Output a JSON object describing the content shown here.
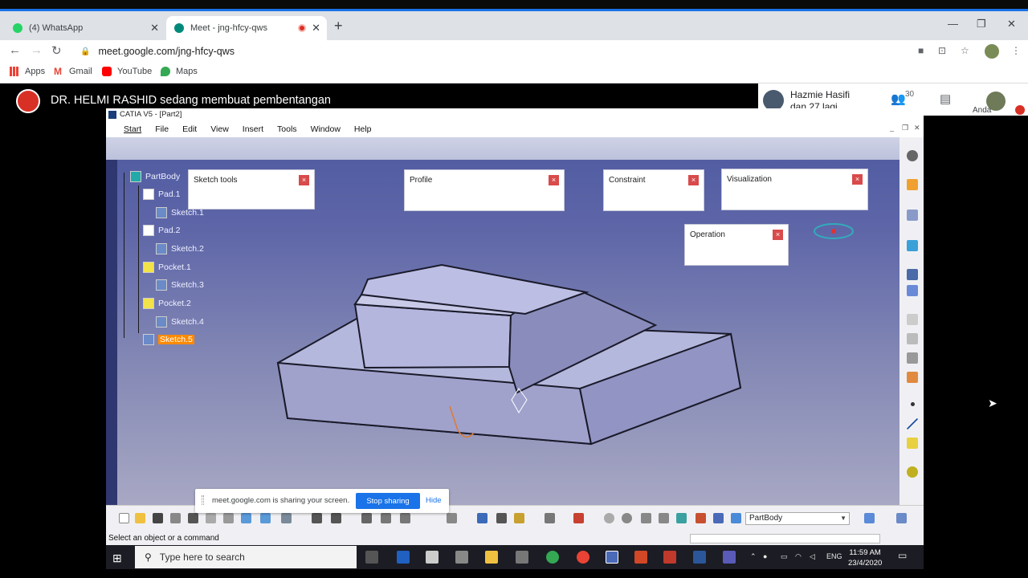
{
  "browser": {
    "tabs": [
      {
        "label": "(4) WhatsApp",
        "active": false
      },
      {
        "label": "Meet - jng-hfcy-qws",
        "active": true
      }
    ],
    "url": "meet.google.com/jng-hfcy-qws",
    "bookmarks": [
      "Apps",
      "Gmail",
      "YouTube",
      "Maps"
    ]
  },
  "meet": {
    "presenter_text": "DR. HELMI RASHID sedang membuat pembentangan",
    "participant_name": "Hazmie Hasifi",
    "participant_more": "dan 27 lagi",
    "participant_count": "30",
    "self_label": "Anda"
  },
  "catia": {
    "title": "CATIA V5 - [Part2]",
    "menu": [
      "Start",
      "File",
      "Edit",
      "View",
      "Insert",
      "Tools",
      "Window",
      "Help"
    ],
    "tree": [
      {
        "label": "PartBody",
        "level": 0
      },
      {
        "label": "Pad.1",
        "level": 1
      },
      {
        "label": "Sketch.1",
        "level": 2
      },
      {
        "label": "Pad.2",
        "level": 1
      },
      {
        "label": "Sketch.2",
        "level": 2
      },
      {
        "label": "Pocket.1",
        "level": 1
      },
      {
        "label": "Sketch.3",
        "level": 2
      },
      {
        "label": "Pocket.2",
        "level": 1
      },
      {
        "label": "Sketch.4",
        "level": 2
      },
      {
        "label": "Sketch.5",
        "level": 0,
        "selected": true
      }
    ],
    "panels": {
      "sketch_tools": "Sketch tools",
      "profile": "Profile",
      "constraint": "Constraint",
      "visualization": "Visualization",
      "operation": "Operation"
    },
    "close_glyph": "×",
    "body_select": "PartBody",
    "status": "Select an object or a command"
  },
  "share_banner": {
    "text": "meet.google.com is sharing your screen.",
    "stop": "Stop sharing",
    "hide": "Hide"
  },
  "taskbar": {
    "search_placeholder": "Type here to search",
    "lang": "ENG",
    "time": "11:59 AM",
    "date": "23/4/2020"
  }
}
